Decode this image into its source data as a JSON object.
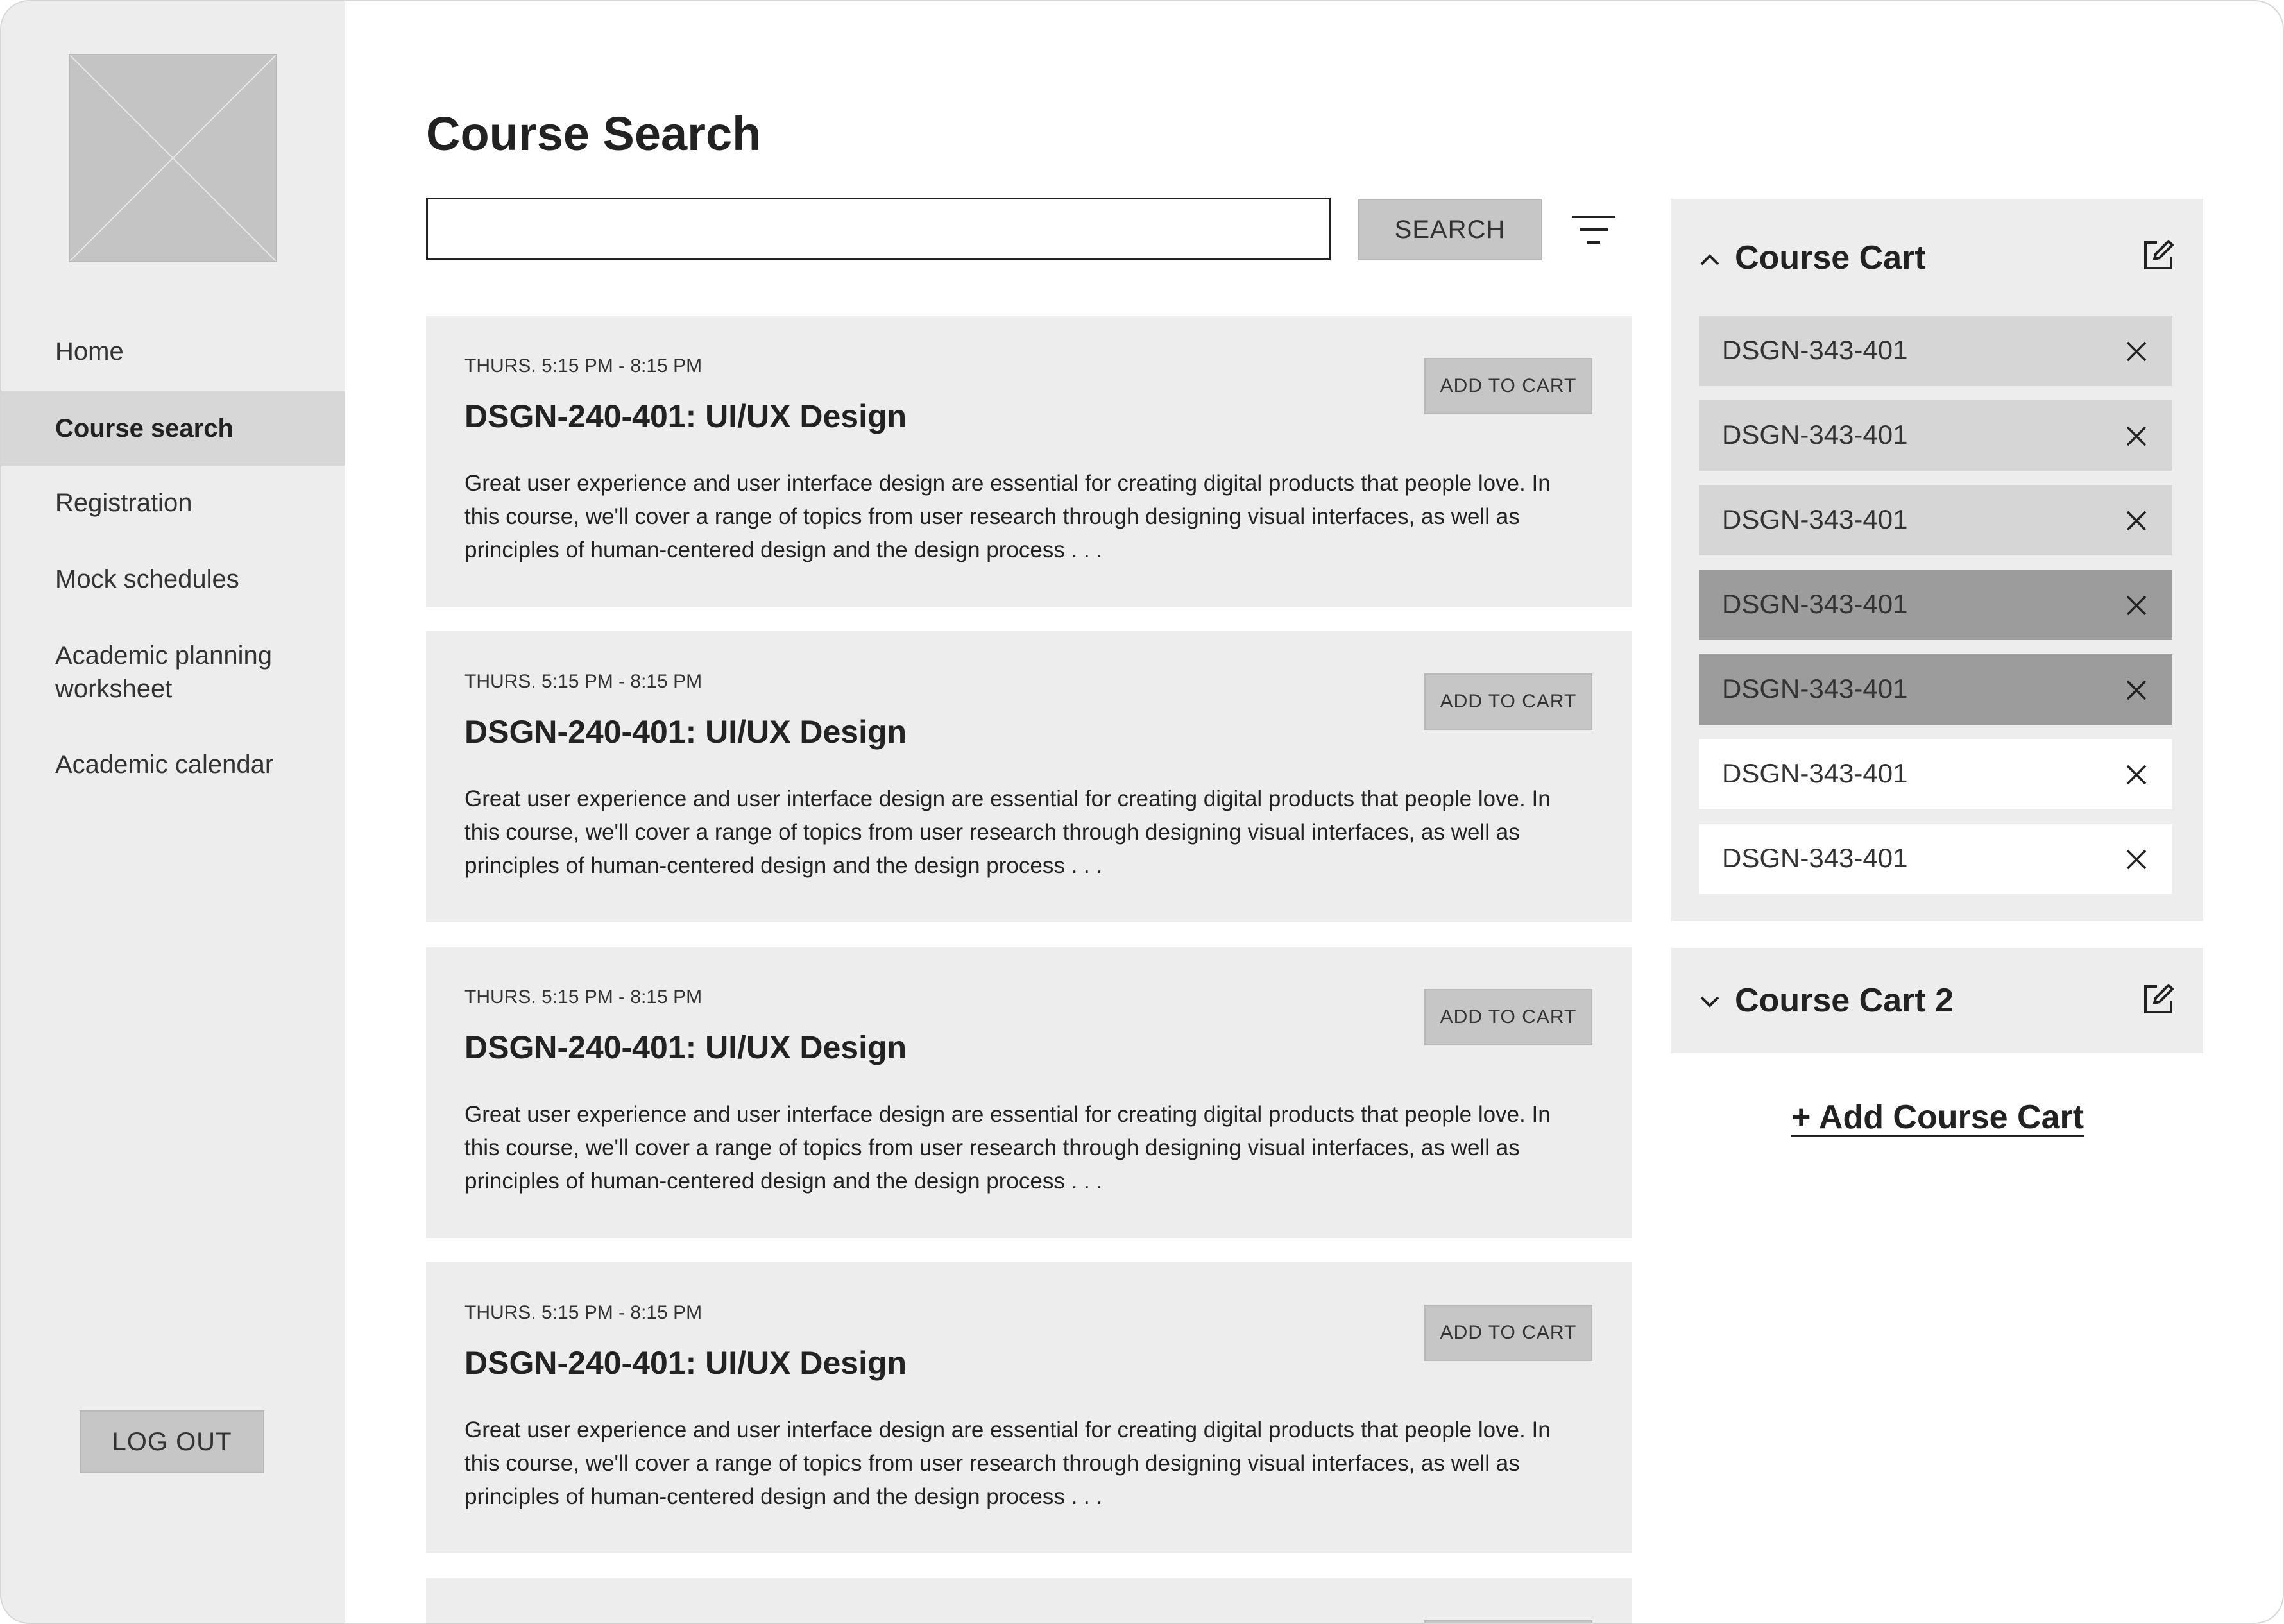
{
  "page_title": "Course Search",
  "sidebar": {
    "items": [
      {
        "label": "Home"
      },
      {
        "label": "Course search"
      },
      {
        "label": "Registration"
      },
      {
        "label": "Mock schedules"
      },
      {
        "label": "Academic planning worksheet"
      },
      {
        "label": "Academic calendar"
      }
    ],
    "active_item": "Course search",
    "logout_label": "LOG OUT"
  },
  "search": {
    "value": "",
    "placeholder": "",
    "button_label": "SEARCH",
    "filter_icon": "filter-icon"
  },
  "courses": [
    {
      "time": "THURS. 5:15 PM - 8:15 PM",
      "title": "DSGN-240-401: UI/UX Design",
      "description": "Great user experience and user interface design are essential for creating digital products that people love. In this course, we'll cover a range of topics from user research through designing visual interfaces, as well as principles of human-centered design and the design process . . .",
      "button_label": "ADD TO CART"
    },
    {
      "time": "THURS. 5:15 PM - 8:15 PM",
      "title": "DSGN-240-401: UI/UX Design",
      "description": "Great user experience and user interface design are essential for creating digital products that people love. In this course, we'll cover a range of topics from user research through designing visual interfaces, as well as principles of human-centered design and the design process . . .",
      "button_label": "ADD TO CART"
    },
    {
      "time": "THURS. 5:15 PM - 8:15 PM",
      "title": "DSGN-240-401: UI/UX Design",
      "description": "Great user experience and user interface design are essential for creating digital products that people love. In this course, we'll cover a range of topics from user research through designing visual interfaces, as well as principles of human-centered design and the design process . . .",
      "button_label": "ADD TO CART"
    },
    {
      "time": "THURS. 5:15 PM - 8:15 PM",
      "title": "DSGN-240-401: UI/UX Design",
      "description": "Great user experience and user interface design are essential for creating digital products that people love. In this course, we'll cover a range of topics from user research through designing visual interfaces, as well as principles of human-centered design and the design process . . .",
      "button_label": "ADD TO CART"
    }
  ],
  "cart": {
    "title": "Course Cart",
    "items": [
      {
        "label": "DSGN-343-401",
        "bg": "#d6d6d6"
      },
      {
        "label": "DSGN-343-401",
        "bg": "#d6d6d6"
      },
      {
        "label": "DSGN-343-401",
        "bg": "#d6d6d6"
      },
      {
        "label": "DSGN-343-401",
        "bg": "#9c9c9c"
      },
      {
        "label": "DSGN-343-401",
        "bg": "#9c9c9c"
      },
      {
        "label": "DSGN-343-401",
        "bg": "#ffffff"
      },
      {
        "label": "DSGN-343-401",
        "bg": "#ffffff"
      }
    ]
  },
  "cart2": {
    "title": "Course Cart 2"
  },
  "add_cart_label": "+ Add Course Cart",
  "colors": {
    "sidebar_bg": "#ededed",
    "active_nav_bg": "#d7d7d7",
    "button_bg": "#c6c6c6",
    "card_bg": "#ededed"
  }
}
